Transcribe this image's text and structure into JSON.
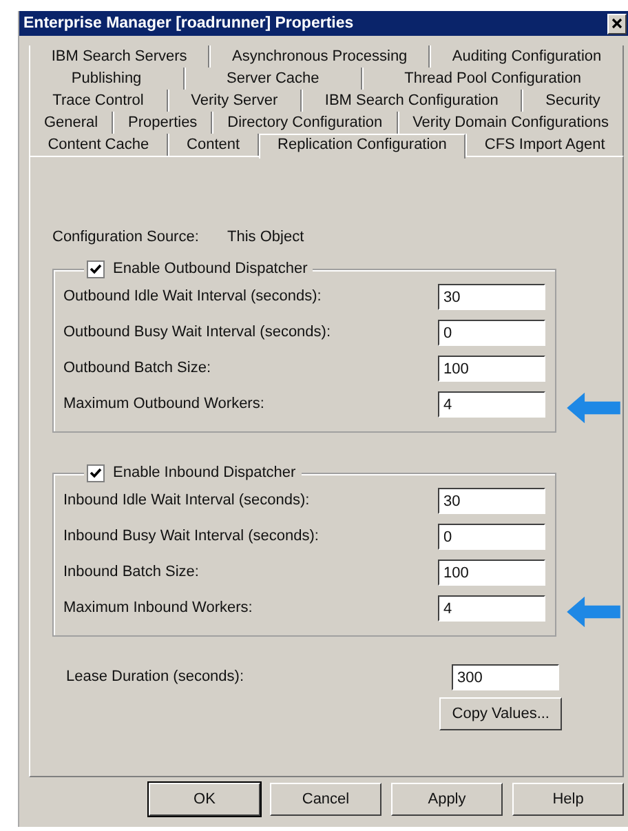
{
  "window": {
    "title": "Enterprise Manager [roadrunner] Properties"
  },
  "tab_rows": [
    [
      {
        "label": "IBM Search Servers",
        "selected": false
      },
      {
        "label": "Asynchronous Processing",
        "selected": false
      },
      {
        "label": "Auditing Configuration",
        "selected": false
      }
    ],
    [
      {
        "label": "Publishing",
        "selected": false
      },
      {
        "label": "Server Cache",
        "selected": false
      },
      {
        "label": "Thread Pool Configuration",
        "selected": false
      }
    ],
    [
      {
        "label": "Trace Control",
        "selected": false
      },
      {
        "label": "Verity Server",
        "selected": false
      },
      {
        "label": "IBM Search Configuration",
        "selected": false
      },
      {
        "label": "Security",
        "selected": false
      }
    ],
    [
      {
        "label": "General",
        "selected": false
      },
      {
        "label": "Properties",
        "selected": false
      },
      {
        "label": "Directory Configuration",
        "selected": false
      },
      {
        "label": "Verity Domain Configurations",
        "selected": false
      }
    ],
    [
      {
        "label": "Content Cache",
        "selected": false
      },
      {
        "label": "Content",
        "selected": false
      },
      {
        "label": "Replication Configuration",
        "selected": true
      },
      {
        "label": "CFS Import Agent",
        "selected": false
      }
    ]
  ],
  "config_source": {
    "label": "Configuration Source:",
    "value": "This Object"
  },
  "groups": [
    {
      "label": "Enable Outbound Dispatcher",
      "checked": true,
      "fields": [
        {
          "label": "Outbound Idle Wait Interval (seconds):",
          "value": "30",
          "highlighted": false
        },
        {
          "label": "Outbound Busy Wait Interval (seconds):",
          "value": "0",
          "highlighted": false
        },
        {
          "label": "Outbound Batch Size:",
          "value": "100",
          "highlighted": false
        },
        {
          "label": "Maximum Outbound Workers:",
          "value": "4",
          "highlighted": true
        }
      ]
    },
    {
      "label": "Enable Inbound Dispatcher",
      "checked": true,
      "fields": [
        {
          "label": "Inbound Idle Wait Interval (seconds):",
          "value": "30",
          "highlighted": false
        },
        {
          "label": "Inbound Busy Wait Interval (seconds):",
          "value": "0",
          "highlighted": false
        },
        {
          "label": "Inbound Batch Size:",
          "value": "100",
          "highlighted": false
        },
        {
          "label": "Maximum Inbound Workers:",
          "value": "4",
          "highlighted": true
        }
      ]
    }
  ],
  "lease": {
    "label": "Lease Duration (seconds):",
    "value": "300"
  },
  "copy_button": "Copy Values...",
  "buttons": [
    {
      "label": "OK",
      "default": true
    },
    {
      "label": "Cancel",
      "default": false
    },
    {
      "label": "Apply",
      "default": false
    },
    {
      "label": "Help",
      "default": false
    }
  ]
}
